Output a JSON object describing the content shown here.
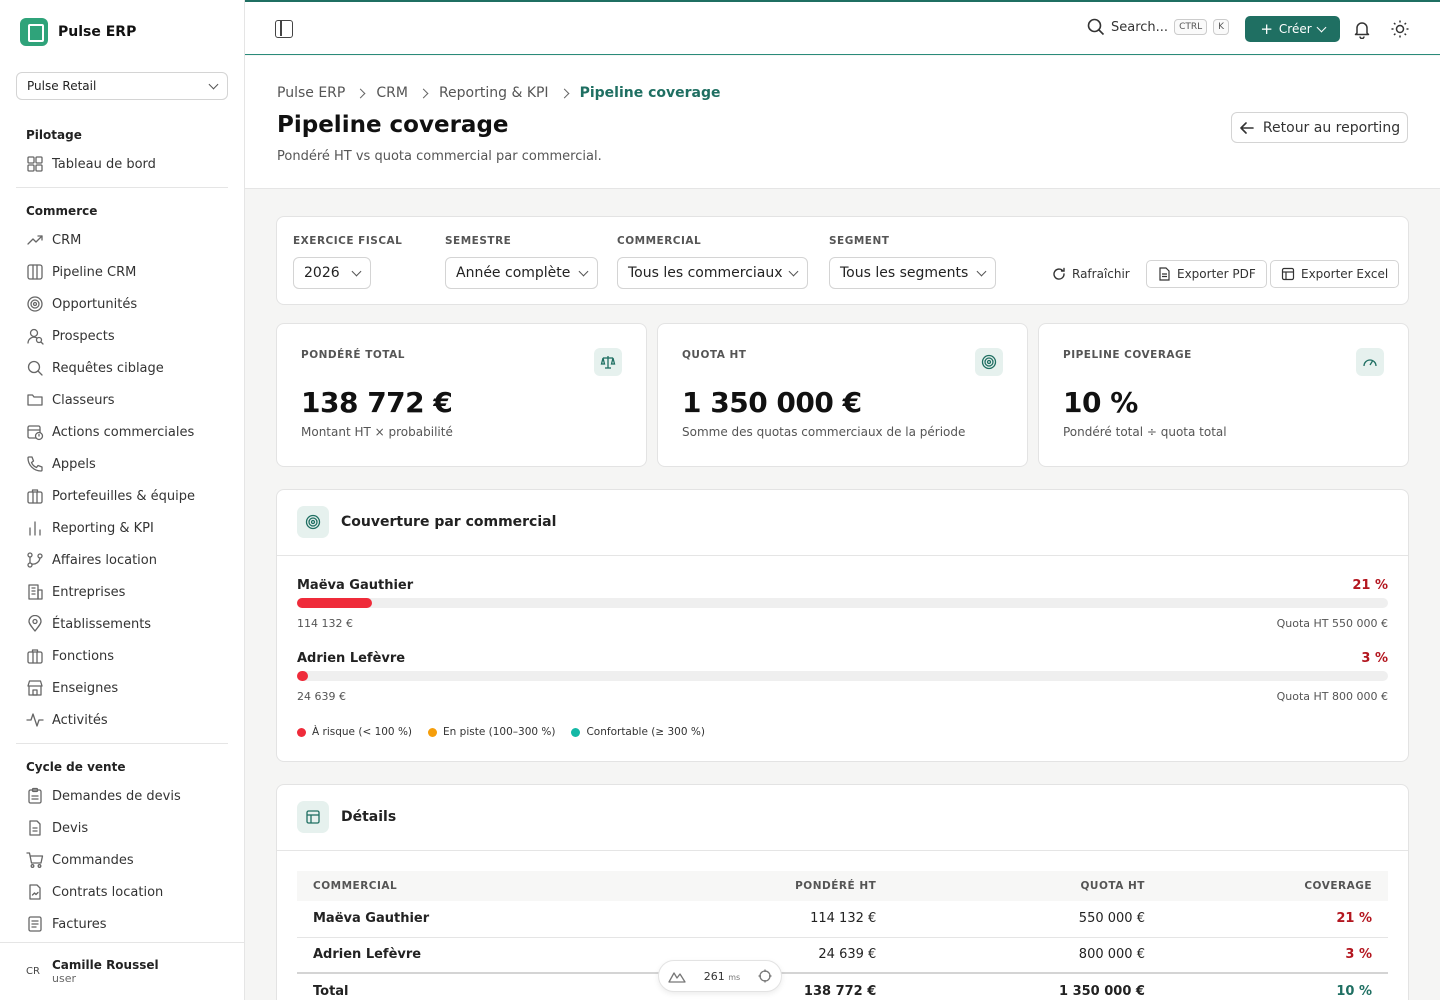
{
  "app": {
    "name": "Pulse ERP",
    "company": "Pulse Retail"
  },
  "sidebar": {
    "sections": [
      {
        "title": "Pilotage",
        "items": [
          {
            "label": "Tableau de bord",
            "icon": "dashboard-icon"
          }
        ]
      },
      {
        "title": "Commerce",
        "items": [
          {
            "label": "CRM",
            "icon": "trend-icon"
          },
          {
            "label": "Pipeline CRM",
            "icon": "columns-icon"
          },
          {
            "label": "Opportunités",
            "icon": "target-icon"
          },
          {
            "label": "Prospects",
            "icon": "user-search-icon"
          },
          {
            "label": "Requêtes ciblage",
            "icon": "search-icon"
          },
          {
            "label": "Classeurs",
            "icon": "folder-icon"
          },
          {
            "label": "Actions commerciales",
            "icon": "calendar-clock-icon"
          },
          {
            "label": "Appels",
            "icon": "phone-icon"
          },
          {
            "label": "Portefeuilles & équipe",
            "icon": "briefcase-icon"
          },
          {
            "label": "Reporting & KPI",
            "icon": "bar-chart-icon"
          },
          {
            "label": "Affaires location",
            "icon": "git-branch-icon"
          },
          {
            "label": "Entreprises",
            "icon": "building-icon"
          },
          {
            "label": "Établissements",
            "icon": "map-pin-icon"
          },
          {
            "label": "Fonctions",
            "icon": "briefcase-icon"
          },
          {
            "label": "Enseignes",
            "icon": "store-icon"
          },
          {
            "label": "Activités",
            "icon": "activity-icon"
          }
        ]
      },
      {
        "title": "Cycle de vente",
        "items": [
          {
            "label": "Demandes de devis",
            "icon": "clipboard-icon"
          },
          {
            "label": "Devis",
            "icon": "file-icon"
          },
          {
            "label": "Commandes",
            "icon": "cart-icon"
          },
          {
            "label": "Contrats location",
            "icon": "file-signature-icon"
          },
          {
            "label": "Factures",
            "icon": "invoice-icon"
          }
        ]
      }
    ],
    "user": {
      "initials": "CR",
      "name": "Camille Roussel",
      "role": "user"
    }
  },
  "topbar": {
    "search": "Search...",
    "kbd1": "CTRL",
    "kbd2": "K",
    "create": "Créer"
  },
  "page": {
    "breadcrumb": [
      "Pulse ERP",
      "CRM",
      "Reporting & KPI",
      "Pipeline coverage"
    ],
    "title": "Pipeline coverage",
    "subtitle": "Pondéré HT vs quota commercial par commercial.",
    "back": "Retour au reporting"
  },
  "filters": {
    "fiscal_label": "EXERCICE FISCAL",
    "fiscal_value": "2026",
    "semester_label": "SEMESTRE",
    "semester_value": "Année complète",
    "rep_label": "COMMERCIAL",
    "rep_value": "Tous les commerciaux",
    "segment_label": "SEGMENT",
    "segment_value": "Tous les segments",
    "refresh": "Rafraîchir",
    "export_pdf": "Exporter PDF",
    "export_excel": "Exporter Excel"
  },
  "kpis": [
    {
      "label": "PONDÉRÉ TOTAL",
      "value": "138 772 €",
      "desc": "Montant HT × probabilité",
      "icon": "scale-icon"
    },
    {
      "label": "QUOTA HT",
      "value": "1 350 000 €",
      "desc": "Somme des quotas commerciaux de la période",
      "icon": "target-icon"
    },
    {
      "label": "PIPELINE COVERAGE",
      "value": "10 %",
      "desc": "Pondéré total ÷ quota total",
      "icon": "gauge-icon"
    }
  ],
  "coverage": {
    "title": "Couverture par commercial",
    "reps": [
      {
        "name": "Maëva Gauthier",
        "pct": "21 %",
        "fill": 0.069,
        "amount": "114 132 €",
        "quota": "Quota HT 550 000 €"
      },
      {
        "name": "Adrien Lefèvre",
        "pct": "3 %",
        "fill": 0.01,
        "amount": "24 639 €",
        "quota": "Quota HT 800 000 €"
      }
    ],
    "legend": [
      {
        "label": "À risque (< 100 %)",
        "color": "#ef2b3a"
      },
      {
        "label": "En piste (100–300 %)",
        "color": "#f59e0b"
      },
      {
        "label": "Confortable (≥ 300 %)",
        "color": "#14b8a6"
      }
    ]
  },
  "details": {
    "title": "Détails",
    "headers": [
      "COMMERCIAL",
      "PONDÉRÉ HT",
      "QUOTA HT",
      "COVERAGE"
    ],
    "rows": [
      [
        "Maëva Gauthier",
        "114 132 €",
        "550 000 €",
        "21 %"
      ],
      [
        "Adrien Lefèvre",
        "24 639 €",
        "800 000 €",
        "3 %"
      ]
    ],
    "total": [
      "Total",
      "138 772 €",
      "1 350 000 €",
      "10 %"
    ]
  },
  "perf": {
    "value": "261",
    "unit": "ms"
  }
}
